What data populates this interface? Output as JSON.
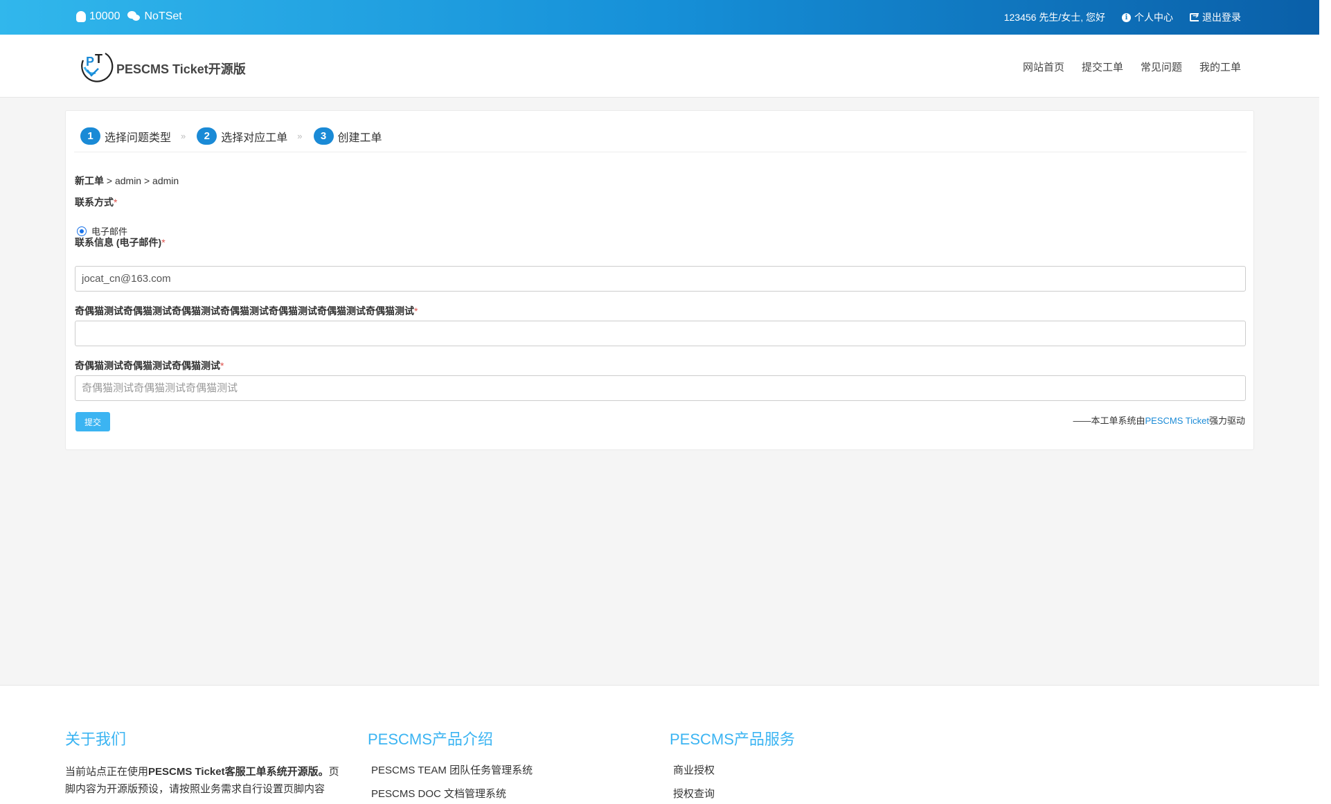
{
  "topbar": {
    "qq": "10000",
    "wechat": "NoTSet",
    "greeting": "123456 先生/女士, 您好",
    "profile": "个人中心",
    "logout": "退出登录"
  },
  "header": {
    "logo_text": "PESCMS Ticket开源版",
    "nav": [
      "网站首页",
      "提交工单",
      "常见问题",
      "我的工单"
    ]
  },
  "steps": [
    {
      "num": "1",
      "label": "选择问题类型"
    },
    {
      "num": "2",
      "label": "选择对应工单"
    },
    {
      "num": "3",
      "label": "创建工单"
    }
  ],
  "step_separator": "»",
  "breadcrumb": {
    "root": "新工单",
    "path": " > admin > admin"
  },
  "form": {
    "contact_method_label": "联系方式",
    "contact_option": "电子邮件",
    "contact_info_label": "联系信息 (电子邮件)",
    "contact_info_value": "jocat_cn@163.com",
    "field1_label": "奇偶猫测试奇偶猫测试奇偶猫测试奇偶猫测试奇偶猫测试奇偶猫测试奇偶猫测试",
    "field1_value": "",
    "field2_label": "奇偶猫测试奇偶猫测试奇偶猫测试",
    "field2_placeholder": "奇偶猫测试奇偶猫测试奇偶猫测试",
    "required_mark": "*",
    "submit": "提交"
  },
  "powered": {
    "prefix": "——本工单系统由",
    "link": "PESCMS Ticket",
    "suffix": "强力驱动"
  },
  "footer": {
    "about_title": "关于我们",
    "about_bold": "PESCMS Ticket客服工单系统开源版。",
    "about_prefix": "当前站点正在使用",
    "about_rest": "页脚内容为开源版预设，请按照业务需求自行设置页脚内容",
    "products_title": "PESCMS产品介绍",
    "products": [
      "PESCMS TEAM 团队任务管理系统",
      "PESCMS DOC 文档管理系统"
    ],
    "services_title": "PESCMS产品服务",
    "services": [
      "商业授权",
      "授权查询"
    ]
  },
  "colors": {
    "accent": "#1a8ad6",
    "topbar_start": "#31b7ec",
    "topbar_end": "#0a5fa8",
    "button": "#3bb4f2",
    "required": "#dd514c"
  }
}
